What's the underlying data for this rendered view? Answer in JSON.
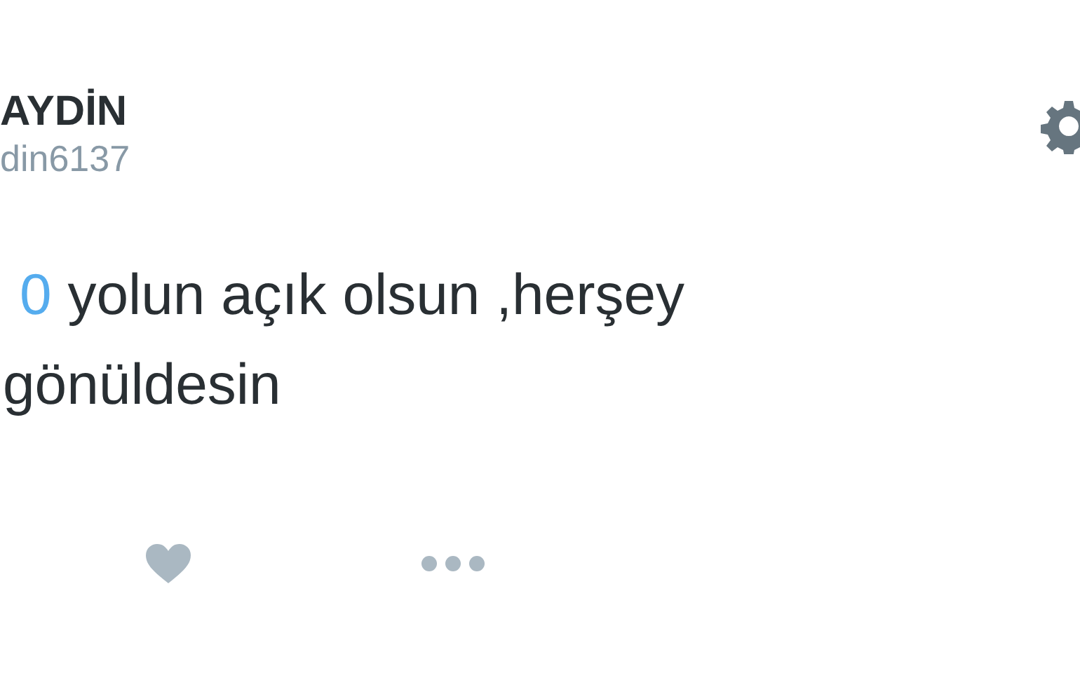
{
  "author": {
    "name": "AYDİN",
    "handle": "din6137"
  },
  "tweet": {
    "link": "0",
    "text": " yolun açık olsun ,herşey",
    "second_line": "gönüldesin"
  }
}
